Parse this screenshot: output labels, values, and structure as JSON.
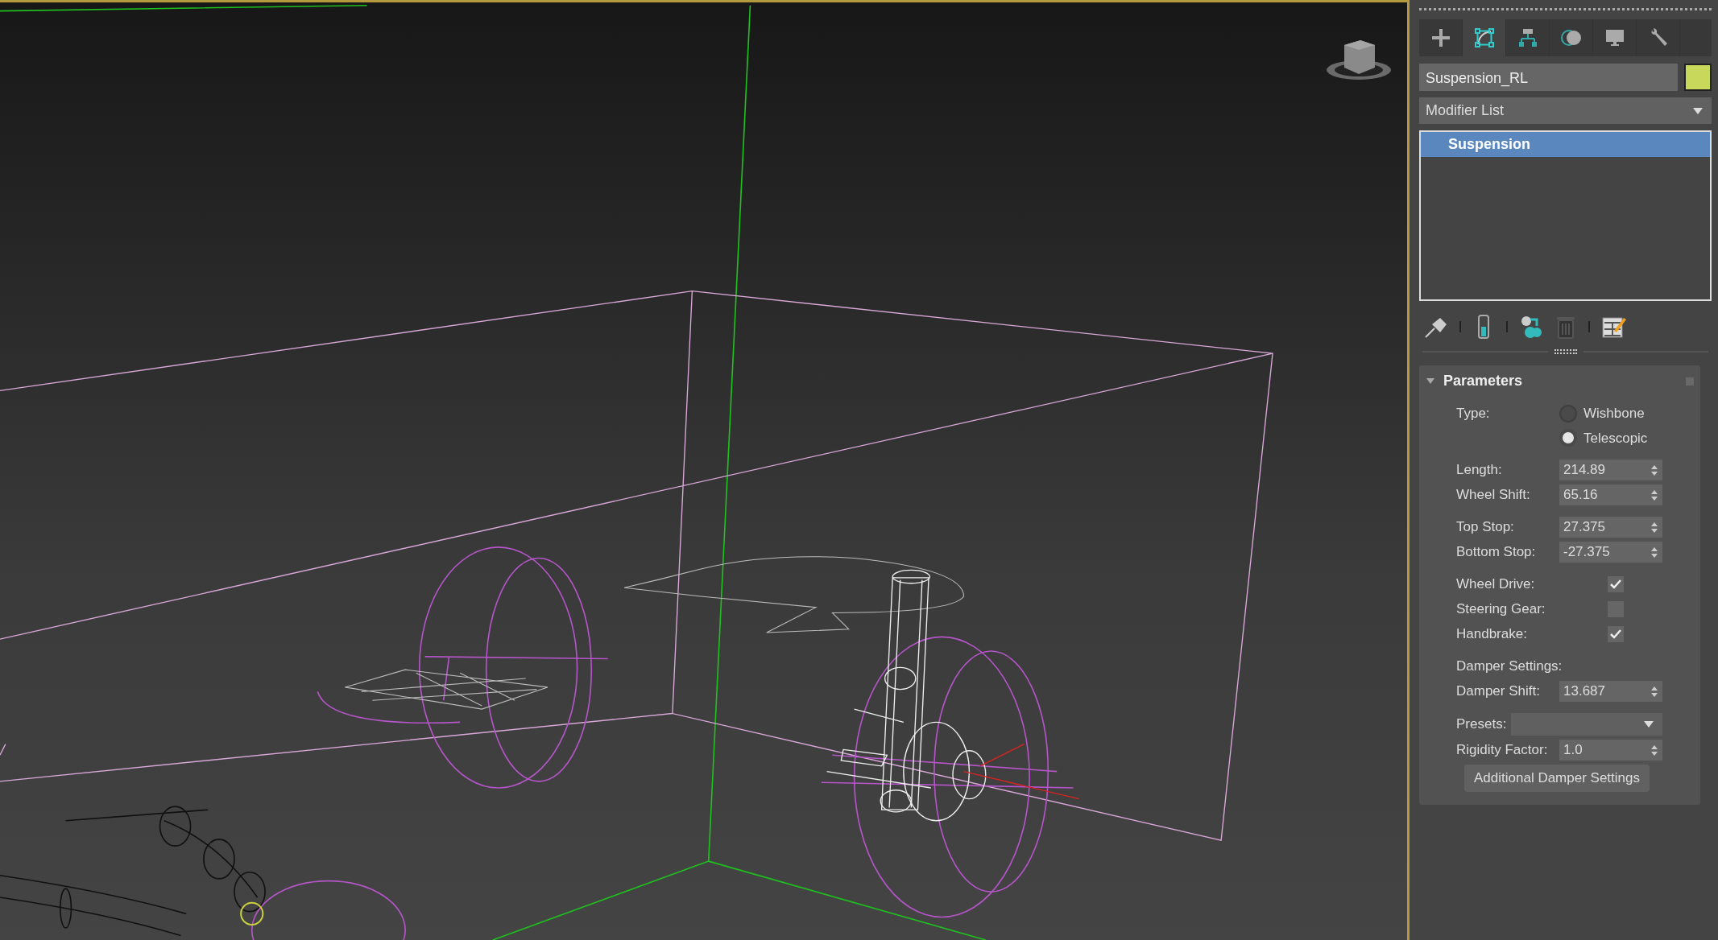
{
  "viewport": {
    "active": true
  },
  "command_panel": {
    "tabs": [
      {
        "kind": "create",
        "selected": false
      },
      {
        "kind": "modify",
        "selected": true
      },
      {
        "kind": "hierarchy",
        "selected": false
      },
      {
        "kind": "motion",
        "selected": false
      },
      {
        "kind": "display",
        "selected": false
      },
      {
        "kind": "utilities",
        "selected": false
      }
    ],
    "object": {
      "name": "Suspension_RL",
      "color": "#c8d85a"
    },
    "modifier_list": "Modifier List",
    "modifier_stack": [
      {
        "label": "Suspension",
        "selected": true
      }
    ],
    "rollout": {
      "title": "Parameters",
      "expanded": true,
      "groups": [
        [
          {
            "kind": "radio",
            "label": "Type:",
            "options": [
              {
                "label": "Wishbone",
                "selected": false
              },
              {
                "label": "Telescopic",
                "selected": true
              }
            ]
          }
        ],
        [
          {
            "kind": "spinner",
            "label": "Length:",
            "value": "214.89"
          },
          {
            "kind": "spinner",
            "label": "Wheel Shift:",
            "value": "65.16"
          }
        ],
        [
          {
            "kind": "spinner",
            "label": "Top Stop:",
            "value": "27.375"
          },
          {
            "kind": "spinner",
            "label": "Bottom Stop:",
            "value": "-27.375"
          }
        ],
        [
          {
            "kind": "checkbox",
            "label": "Wheel Drive:",
            "checked": true
          },
          {
            "kind": "checkbox",
            "label": "Steering Gear:",
            "checked": false
          },
          {
            "kind": "checkbox",
            "label": "Handbrake:",
            "checked": true
          }
        ],
        [
          {
            "kind": "heading",
            "label": "Damper Settings:"
          },
          {
            "kind": "spinner",
            "label": "Damper Shift:",
            "value": "13.687"
          }
        ],
        [
          {
            "kind": "dropdown",
            "label": "Presets:"
          },
          {
            "kind": "spinner",
            "label": "Rigidity Factor:",
            "value": "1.0"
          },
          {
            "kind": "button",
            "label": "Additional Damper Settings"
          }
        ]
      ]
    }
  }
}
